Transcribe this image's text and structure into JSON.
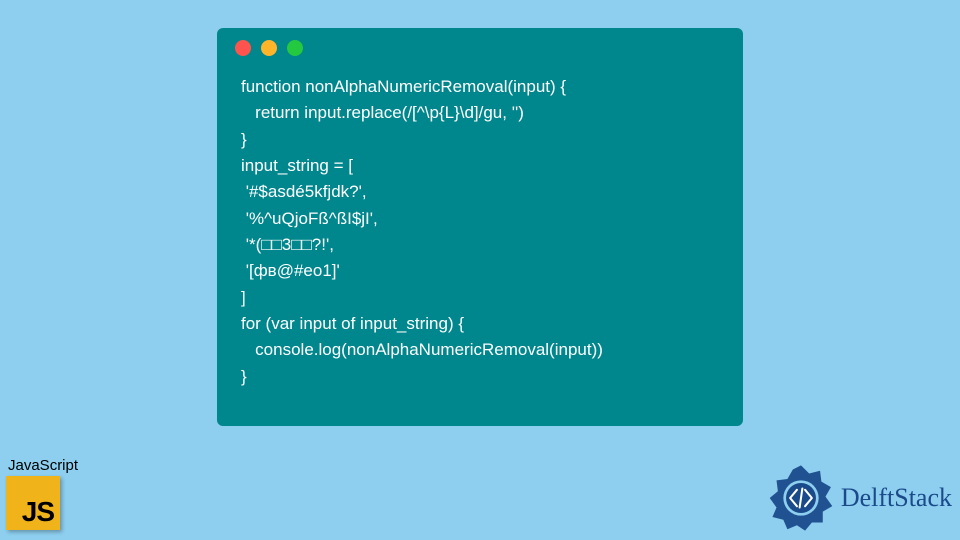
{
  "code": {
    "lines": [
      "function nonAlphaNumericRemoval(input) {",
      "  return input.replace(/[^\\p{L}\\d]/gu, '')",
      "}",
      "input_string = [",
      " '#$asdé5kfjdk?',",
      " '%^uQjoFß^ßI$jI',",
      " '*(□□3□□?!',",
      " '[фв@#eo1]'",
      "]",
      "for (var input of input_string) {",
      "  console.log(nonAlphaNumericRemoval(input))",
      "}"
    ]
  },
  "badge": {
    "language_label": "JavaScript",
    "square_text": "JS"
  },
  "brand": {
    "name": "DelftStack"
  },
  "colors": {
    "page_bg": "#8ecff0",
    "window_bg": "#00878d",
    "code_fg": "#ffffff",
    "js_badge_bg": "#f0b31a",
    "brand_fg": "#1a4a8a",
    "dot_red": "#ff544d",
    "dot_yellow": "#ffb429",
    "dot_green": "#25c93f"
  }
}
